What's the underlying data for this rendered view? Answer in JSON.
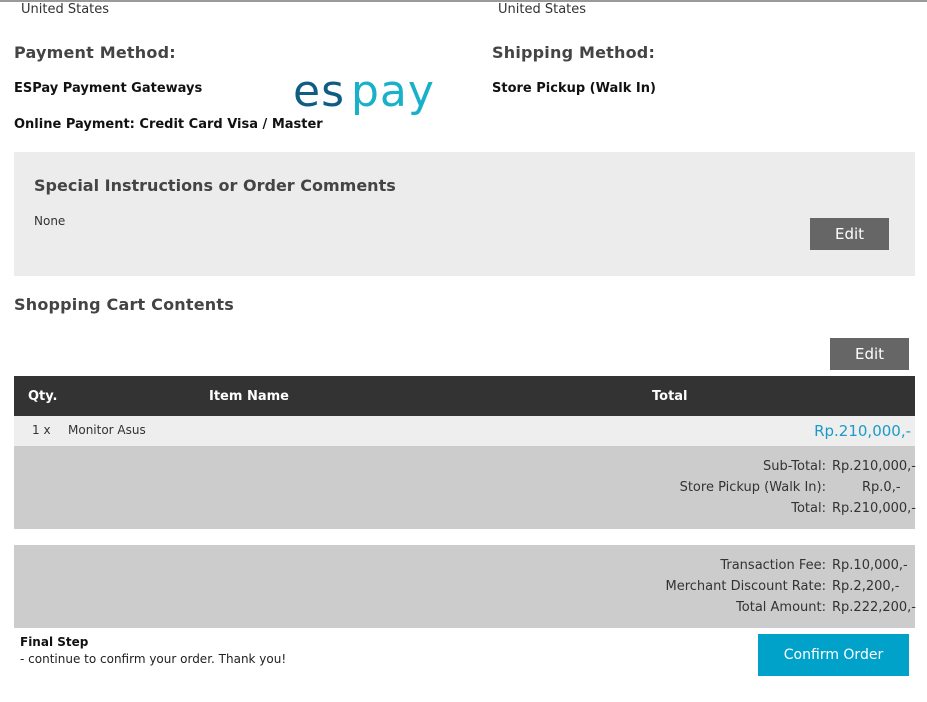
{
  "billing_address": {
    "country": "United States"
  },
  "shipping_address": {
    "country": "United States"
  },
  "payment": {
    "heading": "Payment Method:",
    "gateway": "ESPay Payment Gateways",
    "detail": "Online Payment: Credit Card Visa / Master",
    "logo_text": "espay",
    "logo_color": "#0f5d82",
    "logo_accent_color": "#19b0c9"
  },
  "shipping": {
    "heading": "Shipping Method:",
    "method": "Store Pickup (Walk In)"
  },
  "comments": {
    "title": "Special Instructions or Order Comments",
    "text": "None",
    "edit_label": "Edit"
  },
  "cart": {
    "title": "Shopping Cart Contents",
    "edit_label": "Edit",
    "columns": [
      "Qty.",
      "Item Name",
      "Total"
    ],
    "items": [
      {
        "qty": "1 x",
        "name": "Monitor Asus",
        "total": "Rp.210,000,-"
      }
    ],
    "total_color": "#1a9bc7"
  },
  "totals": [
    {
      "label": "Sub-Total:",
      "value": "Rp.210,000,-"
    },
    {
      "label": "Store Pickup (Walk In):",
      "value": "Rp.0,-"
    },
    {
      "label": "Total:",
      "value": "Rp.210,000,-"
    }
  ],
  "fees": [
    {
      "label": "Transaction Fee:",
      "value": "Rp.10,000,-"
    },
    {
      "label": "Merchant Discount Rate:",
      "value": "Rp.2,200,-"
    },
    {
      "label": "Total Amount:",
      "value": "Rp.222,200,-"
    }
  ],
  "final_step": {
    "title": "Final Step",
    "subtitle": "- continue to confirm your order. Thank you!",
    "confirm_label": "Confirm Order",
    "confirm_color": "#00a2c9"
  }
}
